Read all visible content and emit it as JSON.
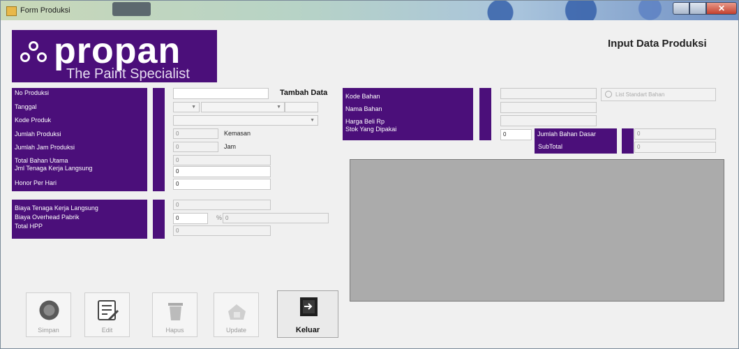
{
  "window": {
    "title": "Form Produksi"
  },
  "header": {
    "brand": "propan",
    "tagline": "The Paint Specialist",
    "page_title": "Input Data Produksi"
  },
  "left_panel": {
    "labels": [
      "No Produksi",
      "Tanggal",
      "Kode Produk",
      "Jumlah Produksi",
      "Jumlah Jam Produksi",
      "Total Bahan Utama",
      "Jml Tenaga Kerja Langsung",
      "Honor Per Hari"
    ],
    "values": {
      "jumlah_produksi": "0",
      "jumlah_jam": "0",
      "total_bahan_utama": "0",
      "jml_tenaga_kerja": "0",
      "honor_per_hari": "0"
    },
    "units": {
      "kemasan": "Kemasan",
      "jam": "Jam"
    },
    "tambah_data": "Tambah Data"
  },
  "cost_panel": {
    "labels": [
      "Biaya Tenaga Kerja Langsung",
      "Biaya Overhead Pabrik",
      "Total HPP"
    ],
    "values": {
      "biaya_tkl": "0",
      "overhead": "0",
      "overhead_pct": "0",
      "total_hpp": "0"
    },
    "percent": "%"
  },
  "material_panel": {
    "labels": [
      "Kode Bahan",
      "Nama Bahan",
      "Harga Beli Rp",
      "Stok Yang Dipakai"
    ],
    "stok_value": "0",
    "search_label": "List Standart Bahan",
    "sub_labels": [
      "Jumlah Bahan Dasar",
      "SubTotal"
    ],
    "jumlah_bahan_dasar": "0",
    "subtotal": "0"
  },
  "buttons": [
    {
      "label": "Simpan",
      "icon": "save-icon"
    },
    {
      "label": "Edit",
      "icon": "edit-icon"
    },
    {
      "label": "Hapus",
      "icon": "trash-icon"
    },
    {
      "label": "Update",
      "icon": "update-icon"
    },
    {
      "label": "Keluar",
      "icon": "exit-icon"
    }
  ],
  "colors": {
    "brand_purple": "#4b0f7a",
    "grid_gray": "#ababab"
  }
}
